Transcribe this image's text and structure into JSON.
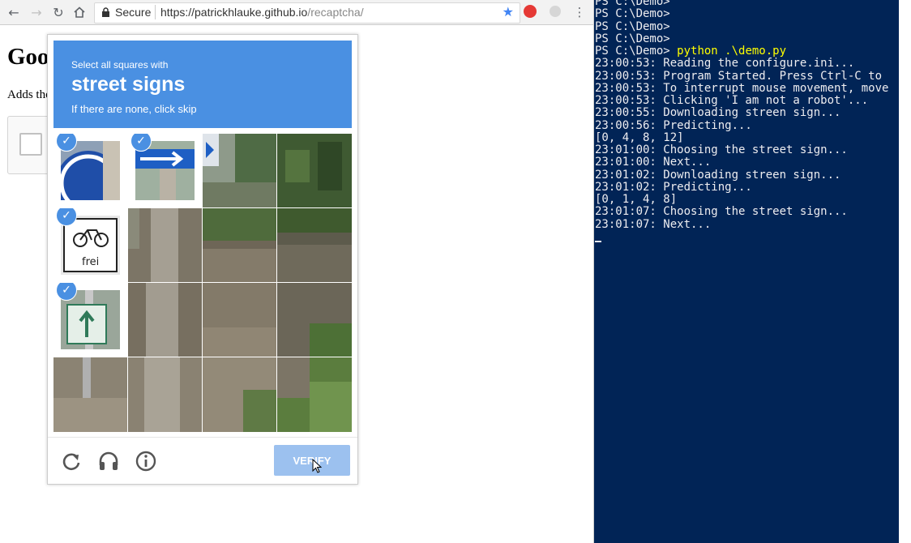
{
  "browser": {
    "secure_label": "Secure",
    "url_base": "https://patrickhlauke.github.io",
    "url_path": "/recaptcha/",
    "page": {
      "title": "Google reCAPTCHA test",
      "description": "Adds the reCAPTCHA widget to a page for testing."
    }
  },
  "captcha": {
    "instruction_line1": "Select all squares with",
    "instruction_target": "street signs",
    "instruction_line3": "If there are none, click skip",
    "verify_label": "VERIFY",
    "selected_tiles": [
      0,
      1,
      4,
      8
    ],
    "colors": {
      "header": "#4a90e2",
      "verify": "#9cc1ef"
    }
  },
  "terminal": {
    "lines": [
      {
        "text": "PS C:\\Demo>"
      },
      {
        "text": "PS C:\\Demo>"
      },
      {
        "text": "PS C:\\Demo>"
      },
      {
        "text": "PS C:\\Demo>"
      },
      {
        "prompt": "PS C:\\Demo> ",
        "command": "python .\\demo.py"
      },
      {
        "text": "23:00:53: Reading the configure.ini..."
      },
      {
        "text": "23:00:53: Program Started. Press Ctrl-C to"
      },
      {
        "text": "23:00:53: To interrupt mouse movement, move"
      },
      {
        "text": "23:00:53: Clicking 'I am not a robot'..."
      },
      {
        "text": "23:00:55: Downloading streen sign..."
      },
      {
        "text": "23:00:56: Predicting..."
      },
      {
        "text": "[0, 4, 8, 12]"
      },
      {
        "text": "23:01:00: Choosing the street sign..."
      },
      {
        "text": "23:01:00: Next..."
      },
      {
        "text": "23:01:02: Downloading streen sign..."
      },
      {
        "text": "23:01:02: Predicting..."
      },
      {
        "text": "[0, 1, 4, 8]"
      },
      {
        "text": "23:01:07: Choosing the street sign..."
      },
      {
        "text": "23:01:07: Next..."
      }
    ],
    "colors": {
      "background": "#012456",
      "text": "#eeedf0",
      "command": "#ffff00"
    }
  }
}
